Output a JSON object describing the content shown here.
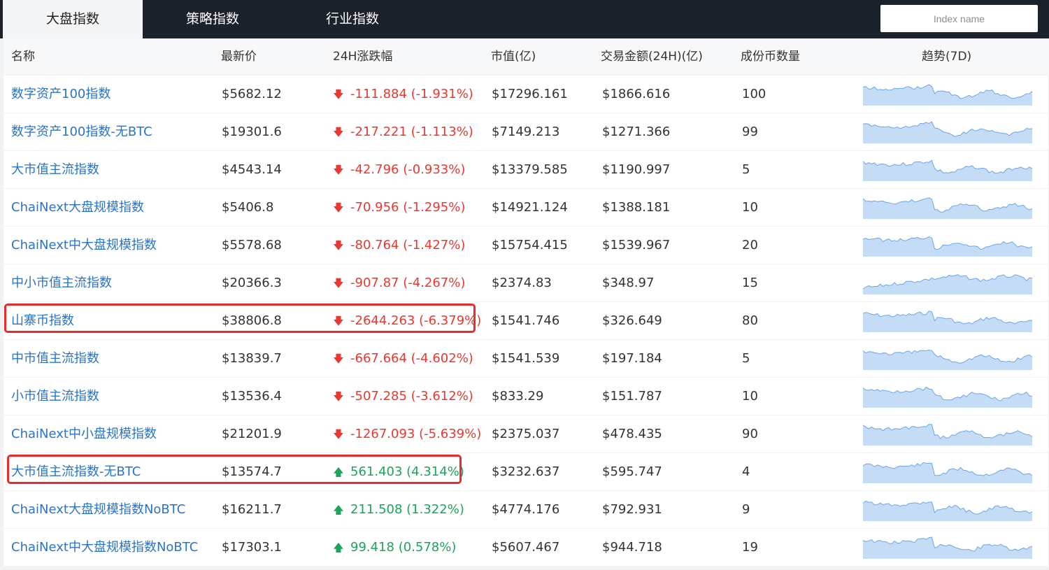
{
  "tabs": [
    {
      "label": "大盘指数",
      "active": true
    },
    {
      "label": "策略指数",
      "active": false
    },
    {
      "label": "行业指数",
      "active": false
    }
  ],
  "search": {
    "placeholder": "Index name"
  },
  "table": {
    "headers": [
      "名称",
      "最新价",
      "24H涨跌幅",
      "市值(亿)",
      "交易金额(24H)(亿)",
      "成份币数量",
      "趋势(7D)"
    ],
    "rows": [
      {
        "name": "数字资产100指数",
        "price": "$5682.12",
        "change": "-111.884 (-1.931%)",
        "direction": "down",
        "market_cap": "$17296.161",
        "volume": "$1866.616",
        "count": "100",
        "highlighted": false
      },
      {
        "name": "数字资产100指数-无BTC",
        "price": "$19301.6",
        "change": "-217.221 (-1.113%)",
        "direction": "down",
        "market_cap": "$7149.213",
        "volume": "$1271.366",
        "count": "99",
        "highlighted": false
      },
      {
        "name": "大市值主流指数",
        "price": "$4543.14",
        "change": "-42.796 (-0.933%)",
        "direction": "down",
        "market_cap": "$13379.585",
        "volume": "$1190.997",
        "count": "5",
        "highlighted": false
      },
      {
        "name": "ChaiNext大盘规模指数",
        "price": "$5406.8",
        "change": "-70.956 (-1.295%)",
        "direction": "down",
        "market_cap": "$14921.124",
        "volume": "$1388.181",
        "count": "10",
        "highlighted": false
      },
      {
        "name": "ChaiNext中大盘规模指数",
        "price": "$5578.68",
        "change": "-80.764 (-1.427%)",
        "direction": "down",
        "market_cap": "$15754.415",
        "volume": "$1539.967",
        "count": "20",
        "highlighted": false
      },
      {
        "name": "中小市值主流指数",
        "price": "$20366.3",
        "change": "-907.87 (-4.267%)",
        "direction": "down",
        "market_cap": "$2374.83",
        "volume": "$348.97",
        "count": "15",
        "highlighted": false
      },
      {
        "name": "山寨币指数",
        "price": "$38806.8",
        "change": "-2644.263 (-6.379%)",
        "direction": "down",
        "market_cap": "$1541.746",
        "volume": "$326.649",
        "count": "80",
        "highlighted": true
      },
      {
        "name": "中市值主流指数",
        "price": "$13839.7",
        "change": "-667.664 (-4.602%)",
        "direction": "down",
        "market_cap": "$1541.539",
        "volume": "$197.184",
        "count": "5",
        "highlighted": false
      },
      {
        "name": "小市值主流指数",
        "price": "$13536.4",
        "change": "-507.285 (-3.612%)",
        "direction": "down",
        "market_cap": "$833.29",
        "volume": "$151.787",
        "count": "10",
        "highlighted": false
      },
      {
        "name": "ChaiNext中小盘规模指数",
        "price": "$21201.9",
        "change": "-1267.093 (-5.639%)",
        "direction": "down",
        "market_cap": "$2375.037",
        "volume": "$478.435",
        "count": "90",
        "highlighted": false
      },
      {
        "name": "大市值主流指数-无BTC",
        "price": "$13574.7",
        "change": "561.403 (4.314%)",
        "direction": "up",
        "market_cap": "$3232.637",
        "volume": "$595.747",
        "count": "4",
        "highlighted": true
      },
      {
        "name": "ChaiNext大盘规模指数NoBTC",
        "price": "$16211.7",
        "change": "211.508 (1.322%)",
        "direction": "up",
        "market_cap": "$4774.176",
        "volume": "$792.931",
        "count": "9",
        "highlighted": false
      },
      {
        "name": "ChaiNext中大盘规模指数NoBTC",
        "price": "$17303.1",
        "change": "99.418 (0.578%)",
        "direction": "up",
        "market_cap": "$5607.467",
        "volume": "$944.718",
        "count": "19",
        "highlighted": false
      }
    ]
  },
  "icons": {
    "down": "arrow-down-icon",
    "up": "arrow-up-icon"
  },
  "colors": {
    "down": "#e8382f",
    "up": "#1aa55a",
    "link": "#2b73c4",
    "highlight": "#e82c2c",
    "spark_line": "#6aa6e8",
    "spark_fill": "#c5dcf6"
  }
}
